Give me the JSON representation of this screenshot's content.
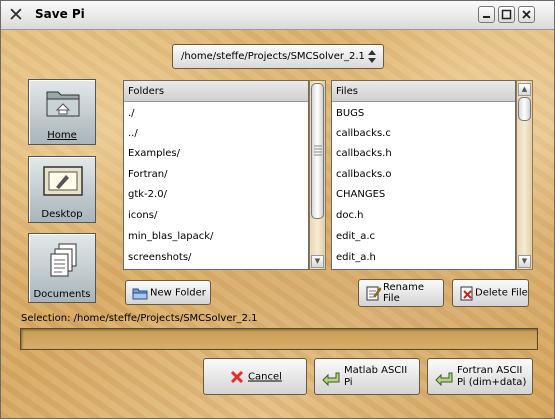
{
  "window": {
    "title": "Save Pi",
    "controls": [
      "minimize-icon",
      "maximize-icon",
      "close-icon"
    ]
  },
  "path_selector": {
    "value": "/home/steffe/Projects/SMCSolver_2.1"
  },
  "sidebar": {
    "items": [
      {
        "label": "Home",
        "icon": "home-folder-icon"
      },
      {
        "label": "Desktop",
        "icon": "desktop-icon"
      },
      {
        "label": "Documents",
        "icon": "documents-icon"
      }
    ]
  },
  "folders": {
    "header": "Folders",
    "items": [
      "./",
      "../",
      "Examples/",
      "Fortran/",
      "gtk-2.0/",
      "icons/",
      "min_blas_lapack/",
      "screenshots/"
    ]
  },
  "files": {
    "header": "Files",
    "items": [
      "BUGS",
      "callbacks.c",
      "callbacks.h",
      "callbacks.o",
      "CHANGES",
      "doc.h",
      "edit_a.c",
      "edit_a.h"
    ]
  },
  "actions": {
    "new_folder": "New Folder",
    "rename_file": "Rename File",
    "delete_file": "Delete File"
  },
  "selection": {
    "label": "Selection: /home/steffe/Projects/SMCSolver_2.1"
  },
  "bottom_buttons": {
    "cancel": "Cancel",
    "matlab_line1": "Matlab ASCII",
    "matlab_line2": "Pi",
    "fortran_line1": "Fortran ASCII",
    "fortran_line2": "Pi (dim+data)"
  },
  "colors": {
    "background": "#d9ad66",
    "panel": "#ffffff",
    "header_bg": "#d6d6d6"
  }
}
